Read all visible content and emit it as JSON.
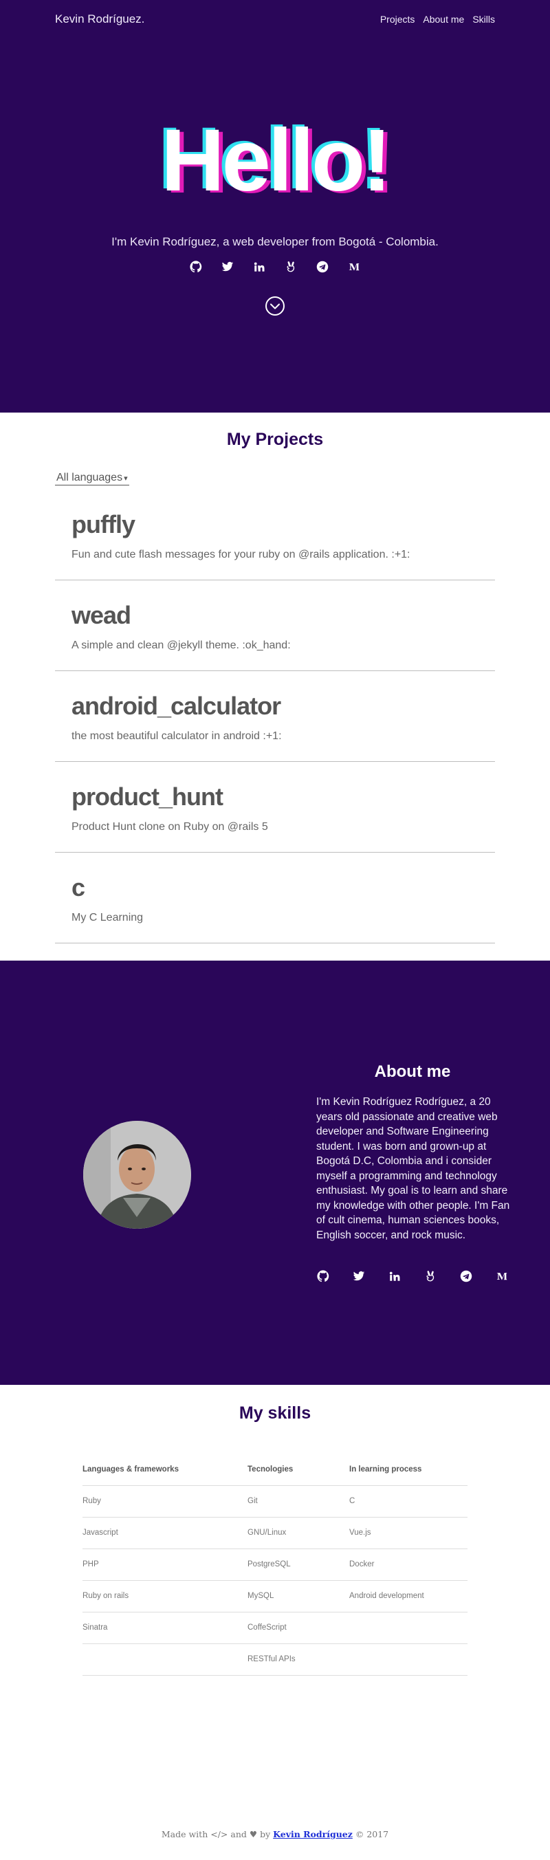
{
  "nav": {
    "brand": "Kevin Rodríguez.",
    "links": [
      "Projects",
      "About me",
      "Skills"
    ]
  },
  "hero": {
    "greeting": "Hello!",
    "tagline": "I'm Kevin Rodríguez, a web developer from Bogotá - Colombia.",
    "socials": [
      "github-icon",
      "twitter-icon",
      "linkedin-icon",
      "angellist-icon",
      "telegram-icon",
      "medium-icon"
    ],
    "colors": {
      "background": "#2a0659",
      "shadow_cyan": "#2fe0f0",
      "shadow_magenta": "#e11bb8"
    }
  },
  "projects": {
    "title": "My Projects",
    "filter": "All languages",
    "items": [
      {
        "name": "puffly",
        "description": "Fun and cute flash messages for your ruby on @rails application. :+1:"
      },
      {
        "name": "wead",
        "description": "A simple and clean @jekyll theme. :ok_hand:"
      },
      {
        "name": "android_calculator",
        "description": "the most beautiful calculator in android :+1:"
      },
      {
        "name": "product_hunt",
        "description": "Product Hunt clone on Ruby on @rails 5"
      },
      {
        "name": "c",
        "description": "My C Learning"
      }
    ]
  },
  "about": {
    "title": "About me",
    "text": "I'm Kevin Rodríguez Rodríguez, a 20 years old passionate and creative web developer and Software Engineering student. I was born and grown-up at Bogotá D.C, Colombia and i consider myself a programming and technology enthusiast. My goal is to learn and share my knowledge with other people. I'm Fan of cult cinema, human sciences books, English soccer, and rock music."
  },
  "skills": {
    "title": "My skills",
    "headers": [
      "Languages & frameworks",
      "Tecnologies",
      "In learning process"
    ],
    "rows": [
      [
        "Ruby",
        "Git",
        "C"
      ],
      [
        "Javascript",
        "GNU/Linux",
        "Vue.js"
      ],
      [
        "PHP",
        "PostgreSQL",
        "Docker"
      ],
      [
        "Ruby on rails",
        "MySQL",
        "Android development"
      ],
      [
        "Sinatra",
        "CoffeScript",
        ""
      ],
      [
        "",
        "RESTful APIs",
        ""
      ]
    ]
  },
  "footer": {
    "made_with": "Made with",
    "code_glyph": "</>",
    "and": "and",
    "by": "by",
    "author": "Kevin Rodríguez",
    "copyright": "© 2017"
  }
}
